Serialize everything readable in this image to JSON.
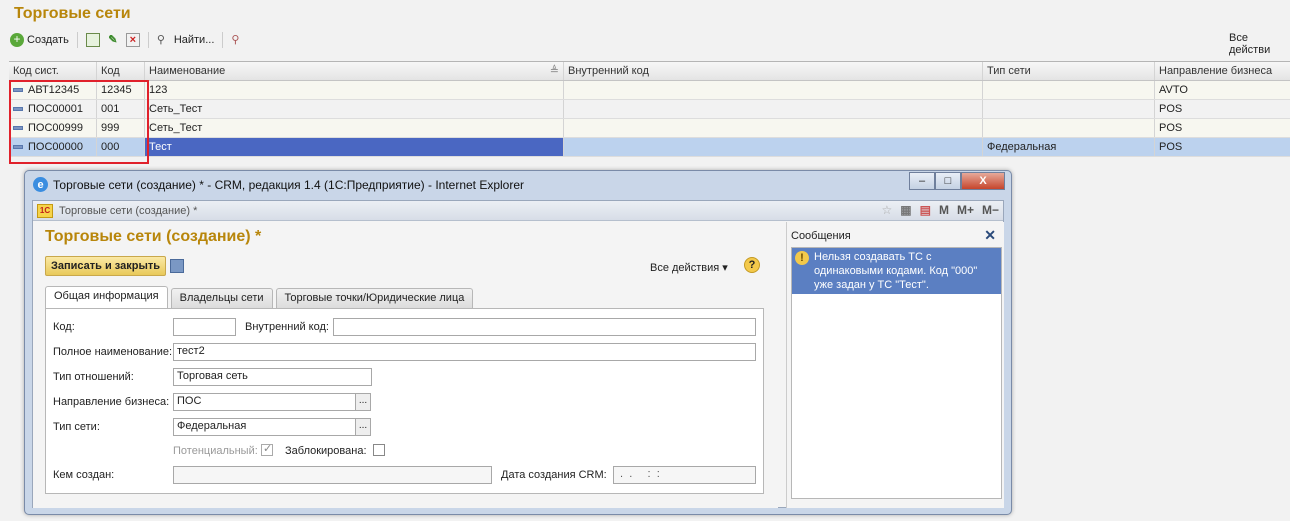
{
  "page": {
    "title": "Торговые сети"
  },
  "toolbar": {
    "create": "Создать",
    "find": "Найти...",
    "all_actions": "Все действи"
  },
  "grid": {
    "headers": [
      "Код сист.",
      "Код",
      "Наименование",
      "Внутренний код",
      "Тип сети",
      "Направление бизнеса"
    ],
    "rows": [
      [
        "АВТ12345",
        "12345",
        "123",
        "",
        "",
        "AVTO"
      ],
      [
        "ПОС00001",
        "001",
        "Сеть_Тест",
        "",
        "",
        "POS"
      ],
      [
        "ПОС00999",
        "999",
        "Сеть_Тест",
        "",
        "",
        "POS"
      ],
      [
        "ПОС00000",
        "000",
        "Тест",
        "",
        "Федеральная",
        "POS"
      ]
    ]
  },
  "window": {
    "title": "Торговые сети (создание) * - CRM, редакция 1.4 (1С:Предприятие) - Internet Explorer",
    "inner_title": "Торговые сети (создание) *",
    "tools": [
      "M",
      "M+",
      "M−"
    ],
    "controls": [
      "‒",
      "□",
      "X"
    ]
  },
  "form": {
    "title": "Торговые сети (создание) *",
    "save_close": "Записать и закрыть",
    "all_actions": "Все действия",
    "help": "?",
    "tabs": [
      "Общая информация",
      "Владельцы сети",
      "Торговые точки/Юридические лица"
    ],
    "fields": {
      "code_label": "Код:",
      "code_value": "",
      "internal_label": "Внутренний код:",
      "internal_value": "",
      "fullname_label": "Полное наименование:",
      "fullname_value": "тест2",
      "relation_label": "Тип отношений:",
      "relation_value": "Торговая сеть",
      "direction_label": "Направление бизнеса:",
      "direction_value": "ПОС",
      "nettype_label": "Тип сети:",
      "nettype_value": "Федеральная",
      "potential_label": "Потенциальный:",
      "blocked_label": "Заблокирована:",
      "creator_label": "Кем создан:",
      "creator_value": "",
      "created_label": "Дата создания CRM:",
      "created_value": " .  .     :  :"
    }
  },
  "messages": {
    "title": "Сообщения",
    "items": [
      "Нельзя создавать ТС с одинаковыми кодами. Код \"000\" уже задан у ТС \"Тест\"."
    ]
  }
}
